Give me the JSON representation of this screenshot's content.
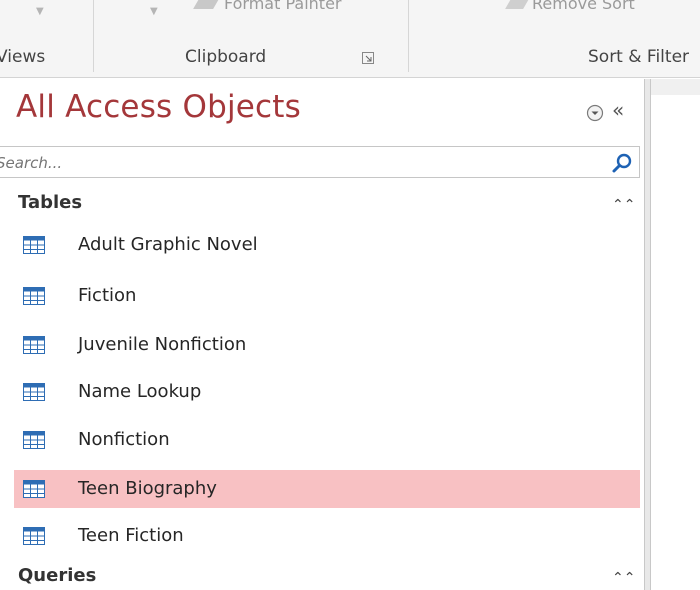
{
  "ribbon": {
    "format_painter": "Format Painter",
    "remove_sort": "Remove Sort",
    "groups": {
      "views": "Views",
      "clipboard": "Clipboard",
      "sort_filter": "Sort & Filter"
    }
  },
  "nav": {
    "title": "All Access Objects",
    "search_placeholder": "Search...",
    "groups": [
      {
        "label": "Tables",
        "items": [
          "Adult Graphic Novel",
          "Fiction",
          "Juvenile Nonfiction",
          "Name Lookup",
          "Nonfiction",
          "Teen Biography",
          "Teen Fiction"
        ]
      },
      {
        "label": "Queries",
        "items": []
      }
    ],
    "selected_item": "Teen Biography",
    "icons": {
      "menu": "chevron-down-circle-icon",
      "collapse": "double-chevron-left-icon",
      "search": "magnifier-icon",
      "table": "table-icon",
      "group_collapse": "double-chevron-up-icon"
    }
  },
  "colors": {
    "title": "#a4373a",
    "selected_row": "#f8c1c3",
    "table_icon": "#2e6db4"
  }
}
